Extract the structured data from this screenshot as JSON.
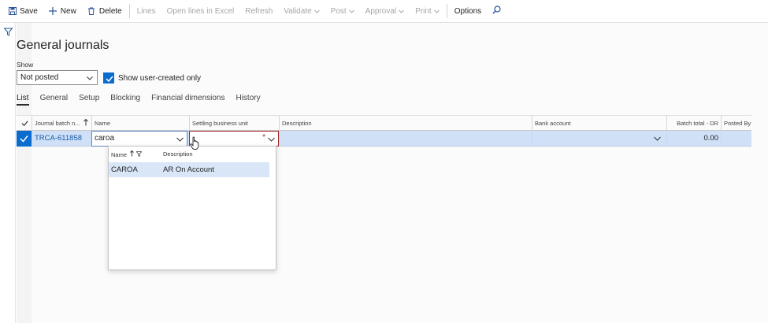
{
  "toolbar": {
    "save": "Save",
    "new": "New",
    "delete": "Delete",
    "lines": "Lines",
    "open_lines_excel": "Open lines in Excel",
    "refresh": "Refresh",
    "validate": "Validate",
    "post": "Post",
    "approval": "Approval",
    "print": "Print",
    "options": "Options"
  },
  "page": {
    "title": "General journals",
    "show_label": "Show",
    "show_value": "Not posted",
    "user_created_label": "Show user-created only"
  },
  "tabs": [
    "List",
    "General",
    "Setup",
    "Blocking",
    "Financial dimensions",
    "History"
  ],
  "grid": {
    "headers": {
      "journal_batch": "Journal batch n...",
      "name": "Name",
      "settling_bu": "Settling business unit",
      "description": "Description",
      "bank_account": "Bank account",
      "batch_total": "Batch total - DR",
      "posted_by": "Posted By"
    },
    "row": {
      "journal_batch": "TRCA-611858",
      "name": "caroa",
      "settling_bu": "",
      "description": "",
      "bank_account": "",
      "batch_total": "0.00",
      "posted_by": ""
    }
  },
  "lookup": {
    "headers": {
      "name": "Name",
      "description": "Description"
    },
    "rows": [
      {
        "name": "CAROA",
        "description": "AR On Account"
      }
    ]
  },
  "colors": {
    "accent": "#0b6cd0",
    "selected_row": "#cfe0f7",
    "required": "#a4262c"
  }
}
